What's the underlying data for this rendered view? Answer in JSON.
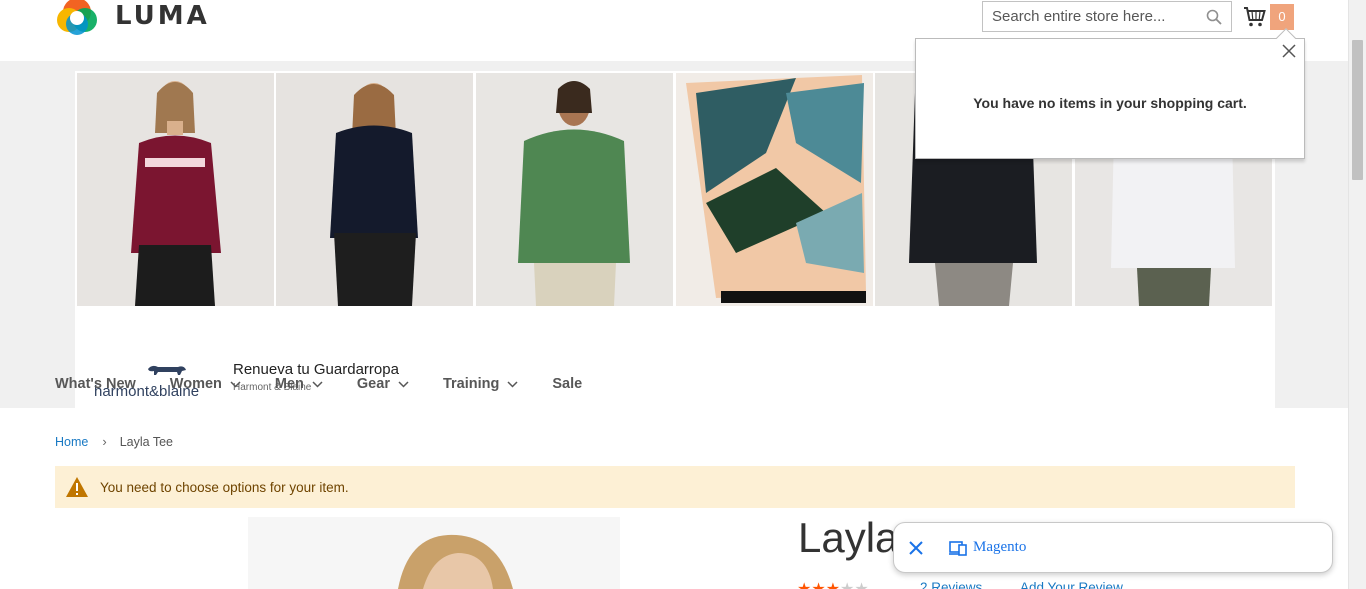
{
  "header": {
    "logo_text": "LUMA",
    "search_placeholder": "Search entire store here...",
    "cart_count": "0"
  },
  "minicart": {
    "empty_message": "You have no items in your shopping cart."
  },
  "ad": {
    "brand": "harmont&blaine",
    "title": "Renueva tu Guardarropa",
    "subtitle": "Harmont & Blaine"
  },
  "nav": {
    "items": [
      {
        "label": "What's New",
        "has_dropdown": false
      },
      {
        "label": "Women",
        "has_dropdown": true
      },
      {
        "label": "Men",
        "has_dropdown": true
      },
      {
        "label": "Gear",
        "has_dropdown": true
      },
      {
        "label": "Training",
        "has_dropdown": true
      },
      {
        "label": "Sale",
        "has_dropdown": false
      }
    ]
  },
  "breadcrumbs": {
    "home": "Home",
    "separator": "›",
    "current": "Layla Tee"
  },
  "message": {
    "text": "You need to choose options for your item."
  },
  "product": {
    "title": "Layla",
    "stars": "★★★☆☆",
    "reviews": "2 Reviews",
    "add_review": "Add Your Review"
  },
  "toast": {
    "label": "Magento"
  },
  "colors": {
    "link": "#1979c3",
    "nav_text": "#575757",
    "warning_bg": "#fdf0d5",
    "cart_badge": "#f0a47c",
    "star": "#ff5501"
  }
}
